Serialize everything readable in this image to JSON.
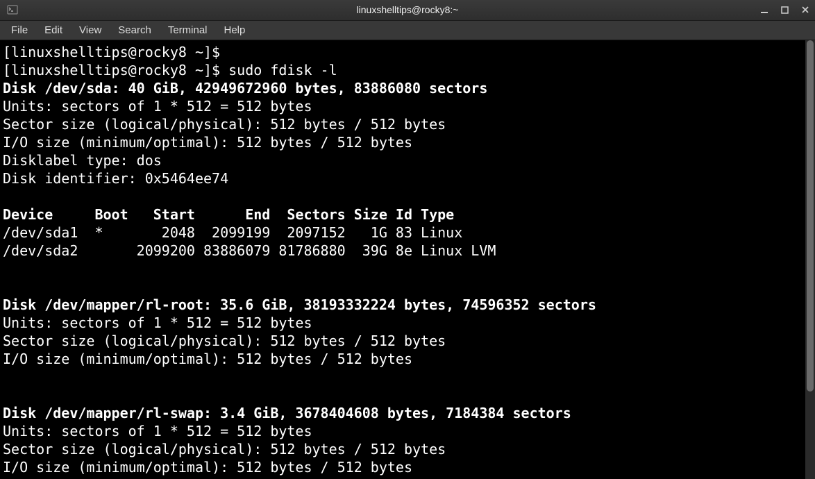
{
  "window": {
    "title": "linuxshelltips@rocky8:~"
  },
  "menu": {
    "items": [
      "File",
      "Edit",
      "View",
      "Search",
      "Terminal",
      "Help"
    ]
  },
  "terminal": {
    "prompt1": "[linuxshelltips@rocky8 ~]$ ",
    "prompt2": "[linuxshelltips@rocky8 ~]$ ",
    "command": "sudo fdisk -l",
    "disk1_header": "Disk /dev/sda: 40 GiB, 42949672960 bytes, 83886080 sectors",
    "disk1_units": "Units: sectors of 1 * 512 = 512 bytes",
    "disk1_sector": "Sector size (logical/physical): 512 bytes / 512 bytes",
    "disk1_io": "I/O size (minimum/optimal): 512 bytes / 512 bytes",
    "disk1_label": "Disklabel type: dos",
    "disk1_id": "Disk identifier: 0x5464ee74",
    "table_header": "Device     Boot   Start      End  Sectors Size Id Type",
    "table_row1": "/dev/sda1  *       2048  2099199  2097152   1G 83 Linux",
    "table_row2": "/dev/sda2       2099200 83886079 81786880  39G 8e Linux LVM",
    "disk2_header": "Disk /dev/mapper/rl-root: 35.6 GiB, 38193332224 bytes, 74596352 sectors",
    "disk2_units": "Units: sectors of 1 * 512 = 512 bytes",
    "disk2_sector": "Sector size (logical/physical): 512 bytes / 512 bytes",
    "disk2_io": "I/O size (minimum/optimal): 512 bytes / 512 bytes",
    "disk3_header": "Disk /dev/mapper/rl-swap: 3.4 GiB, 3678404608 bytes, 7184384 sectors",
    "disk3_units": "Units: sectors of 1 * 512 = 512 bytes",
    "disk3_sector": "Sector size (logical/physical): 512 bytes / 512 bytes",
    "disk3_io": "I/O size (minimum/optimal): 512 bytes / 512 bytes"
  }
}
